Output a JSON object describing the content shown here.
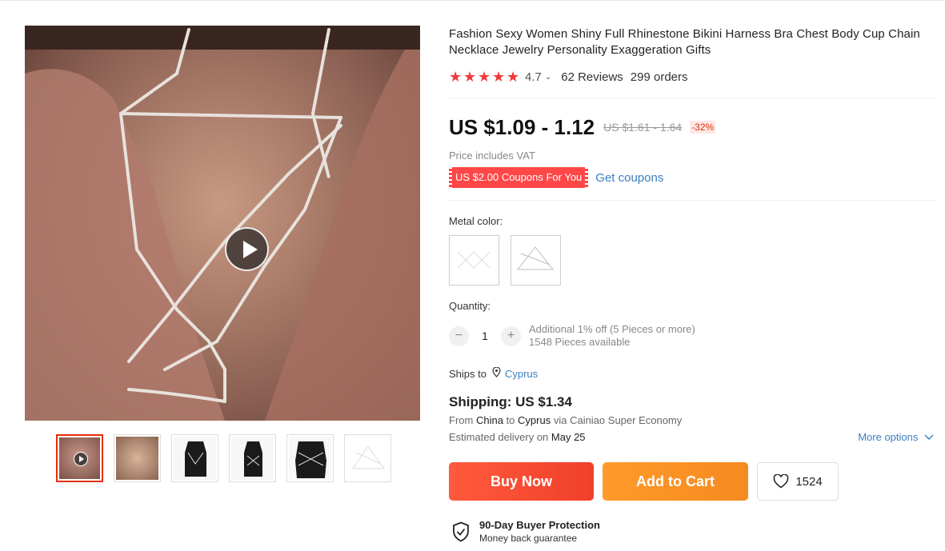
{
  "product": {
    "title": "Fashion Sexy Women Shiny Full Rhinestone Bikini Harness Bra Chest Body Cup Chain Necklace Jewelry Personality Exaggeration Gifts",
    "rating": "4.7",
    "reviews": "62 Reviews",
    "orders": "299 orders",
    "price": "US $1.09 - 1.12",
    "old_price": "US $1.61 - 1.64",
    "discount": "-32%",
    "vat_note": "Price includes VAT",
    "coupon": "US $2.00 Coupons For You",
    "get_coupons": "Get coupons"
  },
  "options": {
    "metal_label": "Metal color:",
    "quantity_label": "Quantity:",
    "quantity_value": "1",
    "minus": "−",
    "plus": "+",
    "additional": "Additional 1% off (5 Pieces or more)",
    "available": "1548 Pieces available"
  },
  "shipping": {
    "ships_to_label": "Ships to",
    "country": "Cyprus",
    "cost": "Shipping: US $1.34",
    "from_prefix": "From",
    "from_country": "China",
    "to_word": "to",
    "to_country": "Cyprus",
    "via": "via Cainiao Super Economy",
    "estimated_prefix": "Estimated delivery on",
    "estimated_date": "May 25",
    "more_options": "More options"
  },
  "actions": {
    "buy_now": "Buy Now",
    "add_to_cart": "Add to Cart",
    "wishlist_count": "1524"
  },
  "protection": {
    "title": "90-Day Buyer Protection",
    "subtitle": "Money back guarantee"
  },
  "colors": {
    "star": "#f03a3a",
    "link": "#3a7ec2",
    "buy": "#f0402a",
    "cart": "#f58a1f",
    "coupon": "#ff4747"
  },
  "icons": [
    "play-icon",
    "star-icon",
    "chevron-down-icon",
    "location-pin-icon",
    "heart-icon",
    "shield-check-icon"
  ]
}
